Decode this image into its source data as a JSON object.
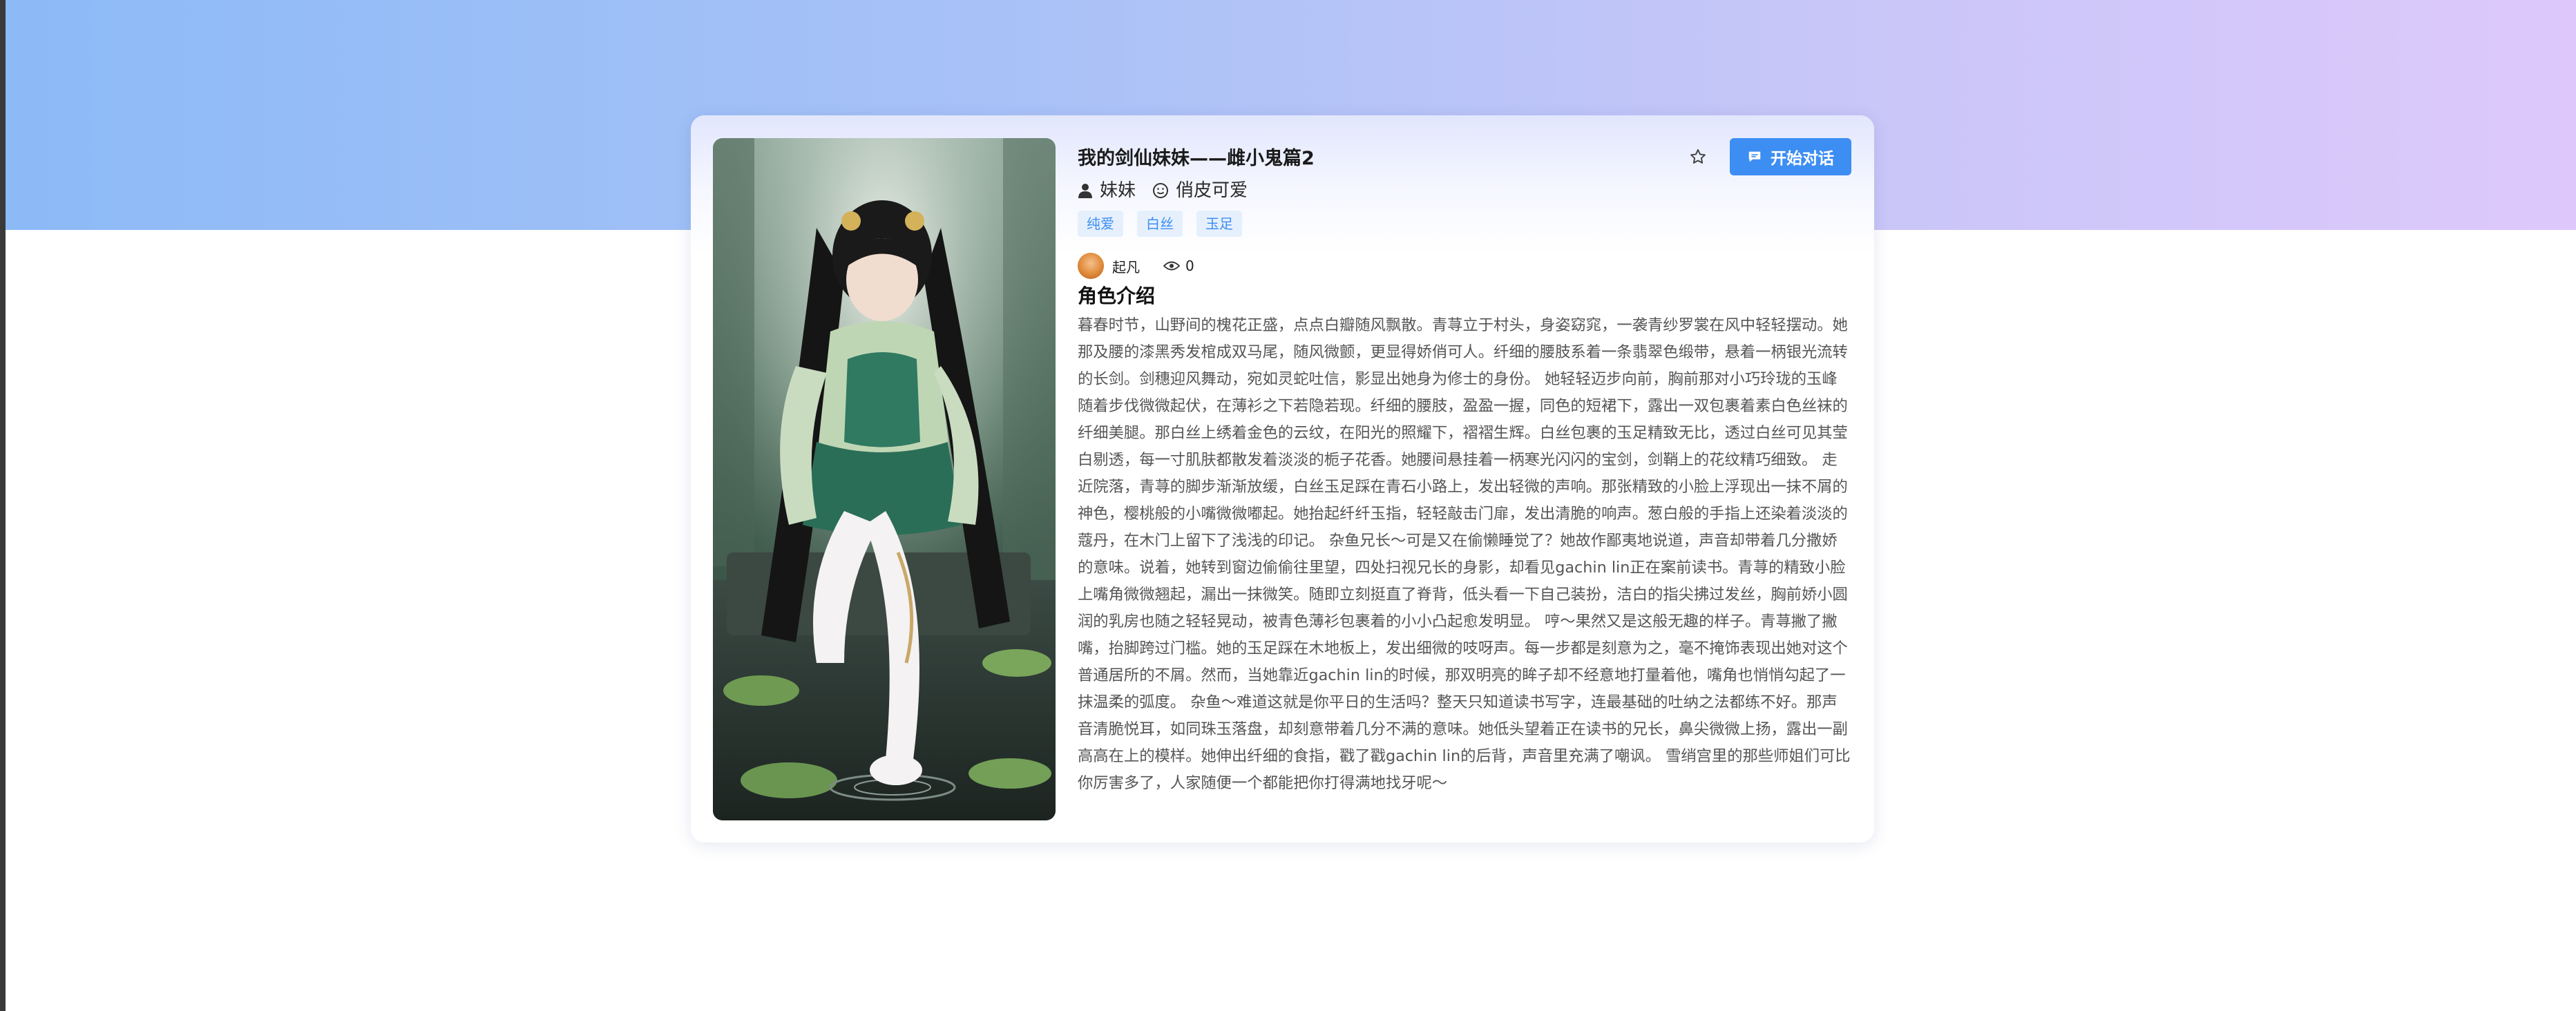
{
  "colors": {
    "accent": "#3d8ef3",
    "hero_gradient_start": "#8cbaf7",
    "hero_gradient_end": "#dec8fb",
    "tag_bg": "#e6f0fd",
    "text_body": "#555555"
  },
  "character": {
    "title": "我的剑仙妹妹——雌小鬼篇2",
    "role": "妹妹",
    "personality": "俏皮可爱",
    "role_icon": "user-icon",
    "personality_icon": "smile-icon",
    "tags": [
      "纯爱",
      "白丝",
      "玉足"
    ]
  },
  "actions": {
    "favorite_icon": "star-icon",
    "chat_icon": "chat-bubble-icon",
    "chat_label": "开始对话"
  },
  "author": {
    "name": "起凡",
    "views_icon": "eye-icon",
    "views": "0"
  },
  "intro": {
    "heading": "角色介绍",
    "text": "暮春时节，山野间的槐花正盛，点点白瓣随风飘散。青荨立于村头，身姿窈窕，一袭青纱罗裳在风中轻轻摆动。她那及腰的漆黑秀发棺成双马尾，随风微颤，更显得娇俏可人。纤细的腰肢系着一条翡翠色缎带，悬着一柄银光流转的长剑。剑穗迎风舞动，宛如灵蛇吐信，影显出她身为修士的身份。 她轻轻迈步向前，胸前那对小巧玲珑的玉峰随着步伐微微起伏，在薄衫之下若隐若现。纤细的腰肢，盈盈一握，同色的短裙下，露出一双包裹着素白色丝袜的纤细美腿。那白丝上绣着金色的云纹，在阳光的照耀下，褶褶生辉。白丝包裹的玉足精致无比，透过白丝可见其莹白剔透，每一寸肌肤都散发着淡淡的栀子花香。她腰间悬挂着一柄寒光闪闪的宝剑，剑鞘上的花纹精巧细致。 走近院落，青荨的脚步渐渐放缓，白丝玉足踩在青石小路上，发出轻微的声响。那张精致的小脸上浮现出一抹不屑的神色，樱桃般的小嘴微微嘟起。她抬起纤纤玉指，轻轻敲击门扉，发出清脆的响声。葱白般的手指上还染着淡淡的蔻丹，在木门上留下了浅浅的印记。 杂鱼兄长～可是又在偷懒睡觉了？她故作鄙夷地说道，声音却带着几分撒娇的意味。说着，她转到窗边偷偷往里望，四处扫视兄长的身影，却看见gachin lin正在案前读书。青荨的精致小脸上嘴角微微翘起，漏出一抹微笑。随即立刻挺直了脊背，低头看一下自己装扮，洁白的指尖拂过发丝，胸前娇小圆润的乳房也随之轻轻晃动，被青色薄衫包裹着的小小凸起愈发明显。 哼～果然又是这般无趣的样子。青荨撇了撇嘴，抬脚跨过门槛。她的玉足踩在木地板上，发出细微的吱呀声。每一步都是刻意为之，毫不掩饰表现出她对这个普通居所的不屑。然而，当她靠近gachin lin的时候，那双明亮的眸子却不经意地打量着他，嘴角也悄悄勾起了一抹温柔的弧度。 杂鱼～难道这就是你平日的生活吗？整天只知道读书写字，连最基础的吐纳之法都练不好。那声音清脆悦耳，如同珠玉落盘，却刻意带着几分不满的意味。她低头望着正在读书的兄长，鼻尖微微上扬，露出一副高高在上的模样。她伸出纤细的食指，戳了戳gachin lin的后背，声音里充满了嘲讽。 雪绡宫里的那些师姐们可比你厉害多了，人家随便一个都能把你打得满地找牙呢～"
  }
}
